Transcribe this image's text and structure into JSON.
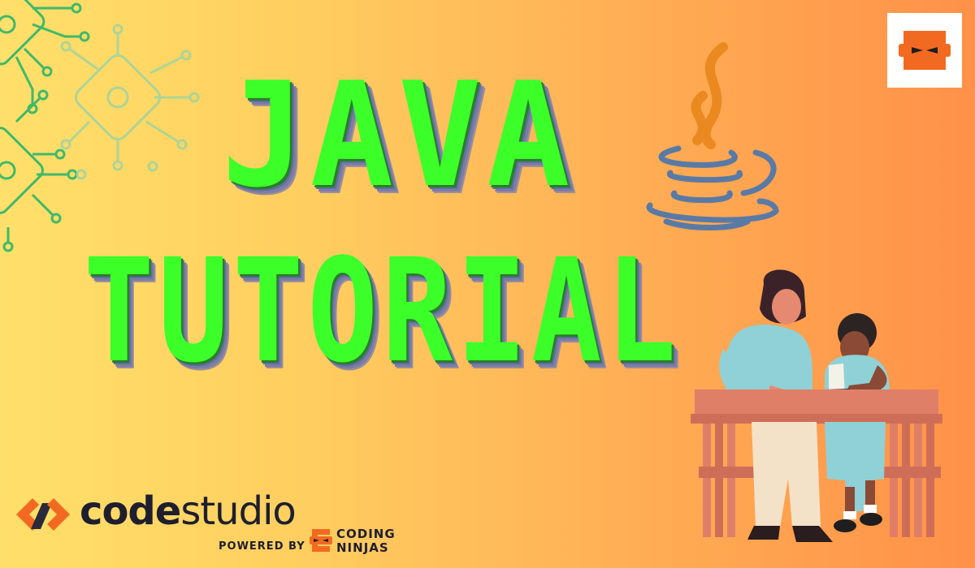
{
  "title": {
    "line1": "JAVA",
    "line2": "TUTORIAL"
  },
  "brand": {
    "name_part1": "code",
    "name_part2": "studio",
    "powered_by": "POWERED BY",
    "partner_line1": "CODING",
    "partner_line2": "NINJAS"
  },
  "colors": {
    "background_start": "#ffe06a",
    "background_end": "#ff9148",
    "title_green": "#3cff2a",
    "title_shadow_blue": "#5f6ea4",
    "java_orange": "#e9891f",
    "java_blue": "#5a7aa6",
    "brand_orange": "#f26a21"
  },
  "icons": [
    "circuit-chip-icon",
    "java-logo-icon",
    "coding-ninjas-logo-icon",
    "code-studio-logo-icon"
  ]
}
